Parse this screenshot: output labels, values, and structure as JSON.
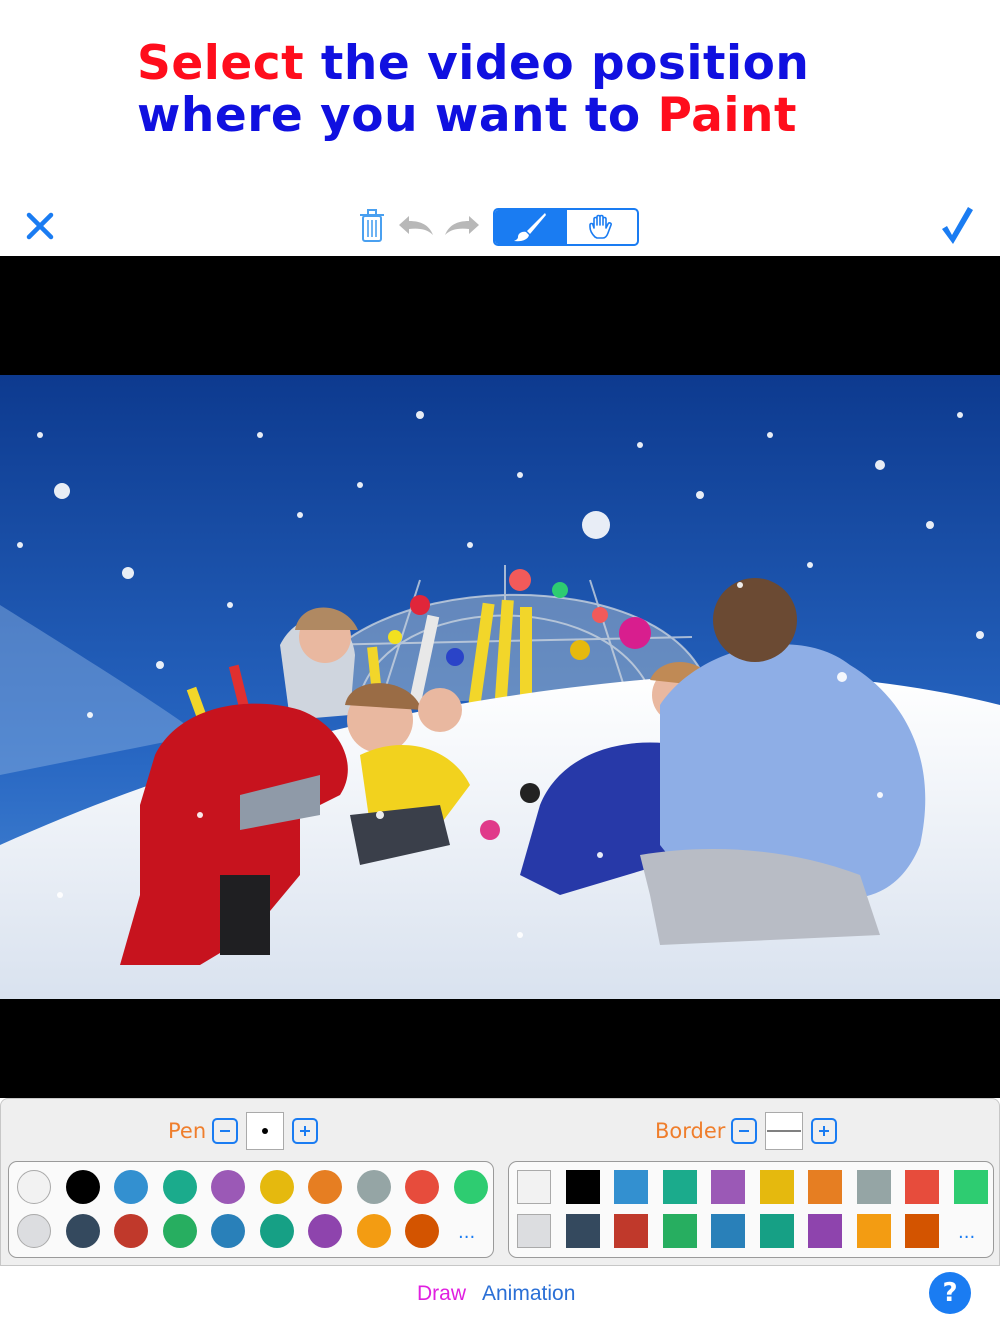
{
  "headline": {
    "line1_red": "Select",
    "line1_blue": " the video position",
    "line2_blue": "where you want to ",
    "line2_red": "Paint"
  },
  "toolbar": {
    "close_icon": "close-icon",
    "trash_icon": "trash-icon",
    "undo_icon": "undo-icon",
    "redo_icon": "redo-icon",
    "brush_icon": "paintbrush-icon",
    "hand_icon": "hand-icon",
    "done_icon": "checkmark-icon",
    "active_mode": "brush"
  },
  "pen": {
    "label": "Pen",
    "minus_icon": "minus-icon",
    "plus_icon": "plus-icon"
  },
  "border": {
    "label": "Border",
    "minus_icon": "minus-icon",
    "plus_icon": "plus-icon"
  },
  "palette": {
    "row1": [
      "#f2f2f2",
      "#000000",
      "#3390d0",
      "#1bab8c",
      "#9b59b6",
      "#e5b90e",
      "#e67e22",
      "#95a5a5",
      "#e74c3c",
      "#2ecc71"
    ],
    "row2": [
      "#dcdde0",
      "#34495e",
      "#c0392b",
      "#27ae60",
      "#2980b9",
      "#16a085",
      "#8e44ad",
      "#f39c12",
      "#d35400"
    ],
    "more": "..."
  },
  "tabs": {
    "draw": "Draw",
    "animation": "Animation"
  },
  "help": "?",
  "colors": {
    "accent": "#1a7cf2",
    "label_orange": "#ef7e2c",
    "headline_blue": "#1010e0",
    "headline_red": "#ff0d1c",
    "draw_tab": "#e020e0"
  }
}
